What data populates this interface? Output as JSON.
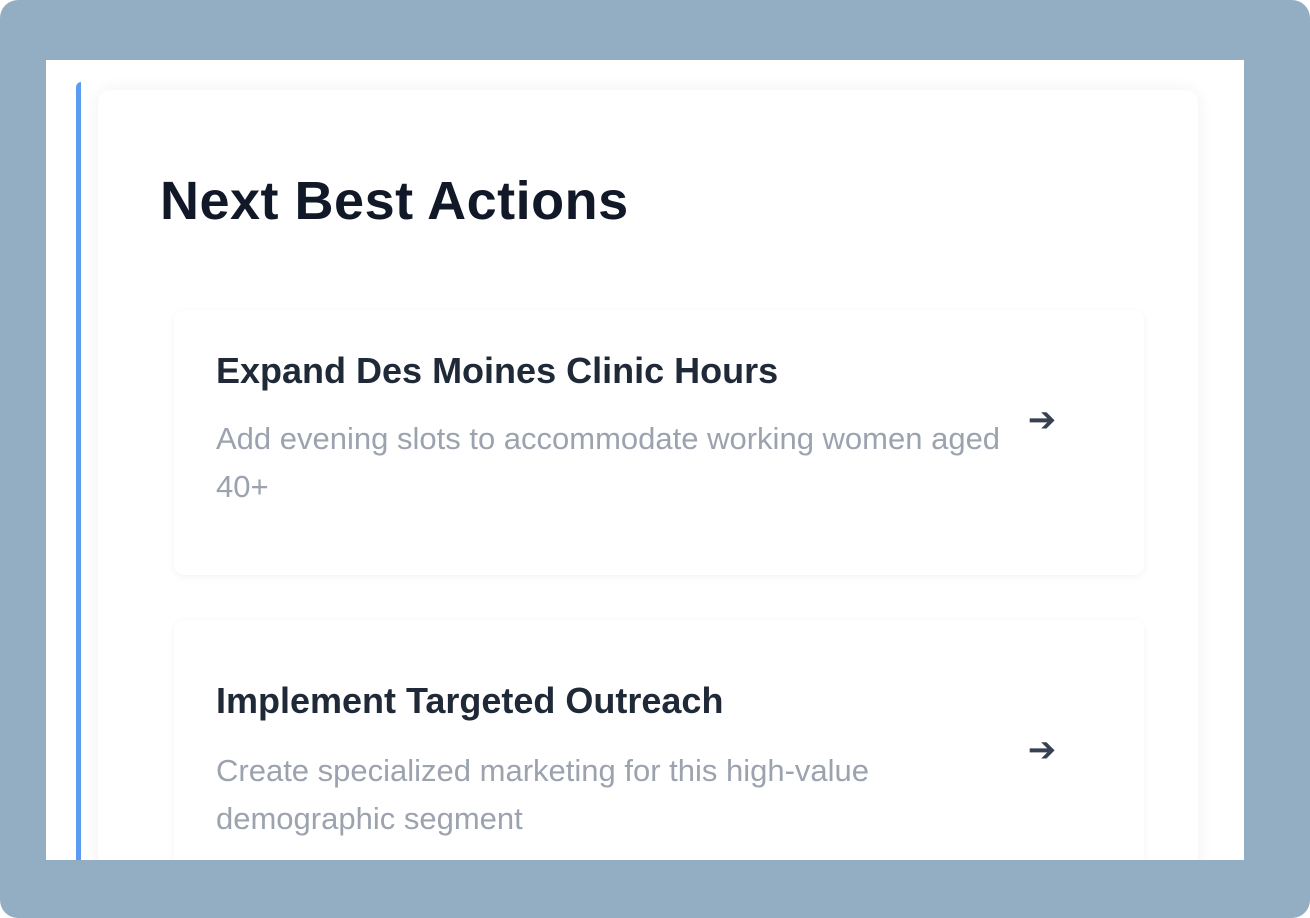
{
  "panel": {
    "title": "Next Best Actions"
  },
  "actions": [
    {
      "title": "Expand Des Moines Clinic Hours",
      "description": "Add evening slots to accommodate working women aged 40+",
      "icon": "arrow-right-icon",
      "icon_glyph": "➔"
    },
    {
      "title": "Implement Targeted Outreach",
      "description": "Create specialized marketing for this high-value demographic segment",
      "icon": "arrow-right-icon",
      "icon_glyph": "➔"
    }
  ],
  "colors": {
    "frame": "#93aec3",
    "accent": "#5b9cf2",
    "title": "#111827",
    "description": "#9ca3af"
  }
}
